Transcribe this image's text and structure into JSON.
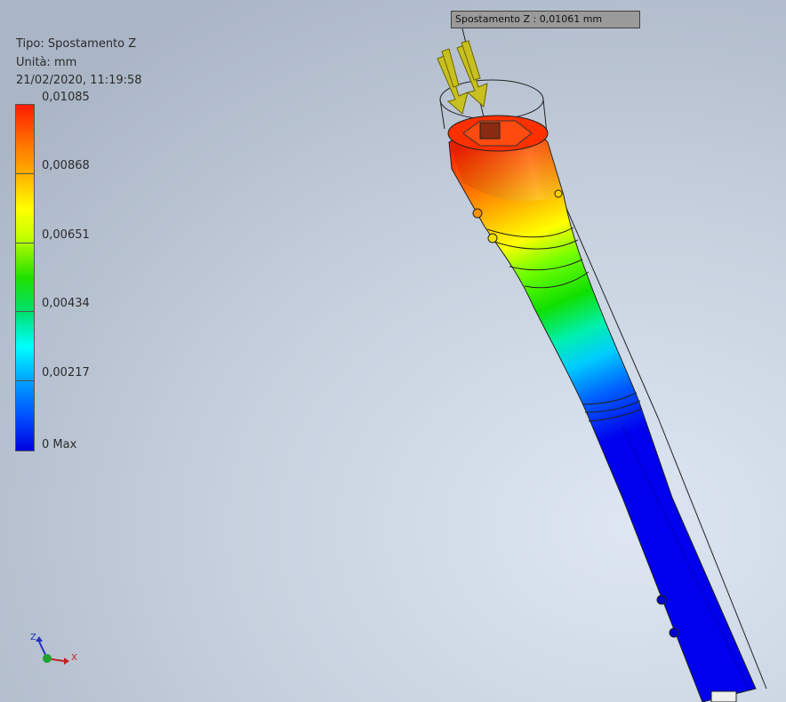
{
  "legend": {
    "type_label": "Tipo: Spostamento Z",
    "units_label": "Unità: mm",
    "timestamp": "21/02/2020, 11:19:58",
    "ticks": [
      "0,01085",
      "0,00868",
      "0,00651",
      "0,00434",
      "0,00217",
      "0 Max"
    ]
  },
  "probe": {
    "label": "Spostamento Z : 0,01061 mm"
  },
  "triad": {
    "z": "Z",
    "x": "X"
  },
  "icons": [
    "load-arrow-icon",
    "view-triad-icon"
  ]
}
